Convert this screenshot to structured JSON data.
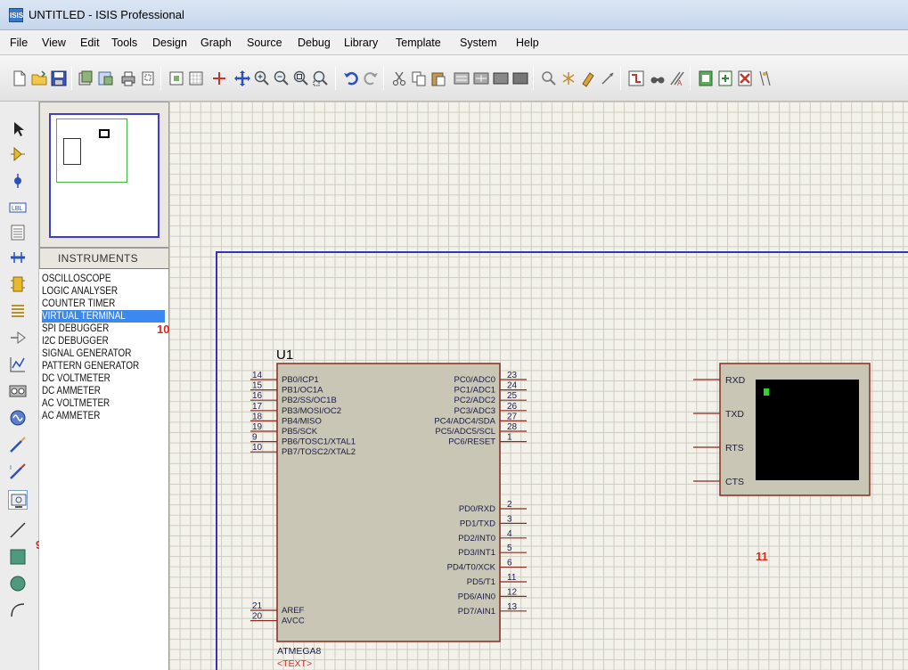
{
  "window": {
    "title": "UNTITLED - ISIS Professional",
    "app_icon_text": "ISIS"
  },
  "menu": [
    "File",
    "View",
    "Edit",
    "Tools",
    "Design",
    "Graph",
    "Source",
    "Debug",
    "Library",
    "Template",
    "System",
    "Help"
  ],
  "toolbar_icons": [
    "new-file-icon",
    "open-folder-icon",
    "save-icon",
    "import-icon",
    "export-icon",
    "print-icon",
    "print-area-icon",
    "refresh-icon",
    "grid-icon",
    "origin-icon",
    "pan-icon",
    "zoom-in-icon",
    "zoom-out-icon",
    "zoom-all-icon",
    "zoom-area-icon",
    "undo-icon",
    "redo-icon",
    "cut-icon",
    "copy-icon",
    "paste-icon",
    "block-copy-icon",
    "block-move-icon",
    "block-rotate-icon",
    "block-delete-icon",
    "pick-device-icon",
    "make-device-icon",
    "packaging-icon",
    "decompose-icon",
    "wire-autorouter-icon",
    "search-tag-icon",
    "property-tool-icon",
    "new-sheet-icon",
    "remove-sheet-icon",
    "exit-to-parent-icon"
  ],
  "left_tools": [
    "selection-mode-icon",
    "component-mode-icon",
    "junction-dot-icon",
    "wire-label-icon",
    "text-script-icon",
    "buses-icon",
    "subcircuit-icon",
    "terminals-icon",
    "device-pins-icon",
    "graph-mode-icon",
    "tape-recorder-icon",
    "generator-mode-icon",
    "voltage-probe-icon",
    "current-probe-icon",
    "virtual-instruments-icon",
    "line-2d-icon",
    "box-2d-icon",
    "circle-2d-icon",
    "arc-2d-icon"
  ],
  "instruments": {
    "header": "INSTRUMENTS",
    "items": [
      "OSCILLOSCOPE",
      "LOGIC ANALYSER",
      "COUNTER TIMER",
      "VIRTUAL TERMINAL",
      "SPI DEBUGGER",
      "I2C DEBUGGER",
      "SIGNAL GENERATOR",
      "PATTERN GENERATOR",
      "DC VOLTMETER",
      "DC AMMETER",
      "AC VOLTMETER",
      "AC AMMETER"
    ],
    "selected_index": 3
  },
  "callouts": {
    "instrument": "10",
    "tool": "9",
    "terminal": "11"
  },
  "chip": {
    "ref": "U1",
    "part": "ATMEGA8",
    "text": "<TEXT>",
    "left_pins": [
      {
        "num": "14",
        "name": "PB0/ICP1"
      },
      {
        "num": "15",
        "name": "PB1/OC1A"
      },
      {
        "num": "16",
        "name": "PB2/SS/OC1B"
      },
      {
        "num": "17",
        "name": "PB3/MOSI/OC2"
      },
      {
        "num": "18",
        "name": "PB4/MISO"
      },
      {
        "num": "19",
        "name": "PB5/SCK"
      },
      {
        "num": "9",
        "name": "PB6/TOSC1/XTAL1"
      },
      {
        "num": "10",
        "name": "PB7/TOSC2/XTAL2"
      }
    ],
    "left_bottom_pins": [
      {
        "num": "21",
        "name": "AREF"
      },
      {
        "num": "20",
        "name": "AVCC"
      }
    ],
    "right_pins_c": [
      {
        "num": "23",
        "name": "PC0/ADC0"
      },
      {
        "num": "24",
        "name": "PC1/ADC1"
      },
      {
        "num": "25",
        "name": "PC2/ADC2"
      },
      {
        "num": "26",
        "name": "PC3/ADC3"
      },
      {
        "num": "27",
        "name": "PC4/ADC4/SDA"
      },
      {
        "num": "28",
        "name": "PC5/ADC5/SCL"
      },
      {
        "num": "1",
        "name": "PC6/RESET"
      }
    ],
    "right_pins_d": [
      {
        "num": "2",
        "name": "PD0/RXD"
      },
      {
        "num": "3",
        "name": "PD1/TXD"
      },
      {
        "num": "4",
        "name": "PD2/INT0"
      },
      {
        "num": "5",
        "name": "PD3/INT1"
      },
      {
        "num": "6",
        "name": "PD4/T0/XCK"
      },
      {
        "num": "11",
        "name": "PD5/T1"
      },
      {
        "num": "12",
        "name": "PD6/AIN0"
      },
      {
        "num": "13",
        "name": "PD7/AIN1"
      }
    ]
  },
  "terminal": {
    "pins": [
      "RXD",
      "TXD",
      "RTS",
      "CTS"
    ],
    "screen_color": "#000000",
    "cursor_color": "#2bd62b"
  },
  "colors": {
    "sheet_border": "#3434b8",
    "chip_fill": "#c9c6b5",
    "chip_stroke": "#8b2a1e",
    "callout": "#e0271f",
    "selection": "#3a88f0"
  }
}
